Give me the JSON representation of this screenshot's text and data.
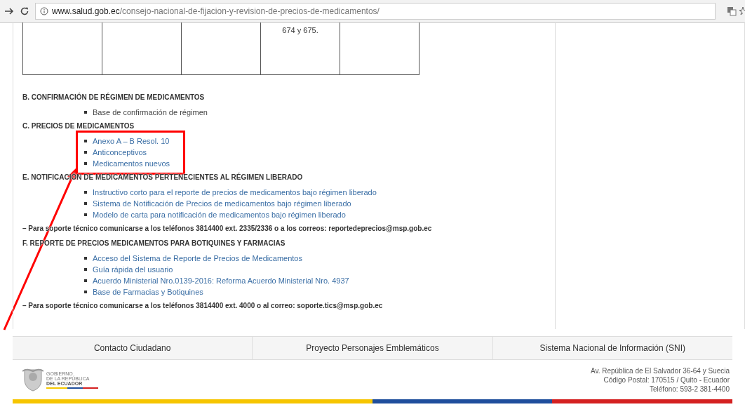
{
  "browser": {
    "url_host": "www.salud.gob.ec",
    "url_path": "/consejo-nacional-de-fijacion-y-revision-de-precios-de-medicamentos/"
  },
  "table": {
    "rows": [
      [
        "",
        "",
        "",
        "674 y 675.",
        ""
      ]
    ]
  },
  "sections": [
    {
      "kind": "heading",
      "text": "B. CONFIRMACIÓN DE RÉGIMEN DE MEDICAMENTOS"
    },
    {
      "kind": "list",
      "items": [
        {
          "text": "Base de confirmación de régimen",
          "link": false
        }
      ]
    },
    {
      "kind": "heading",
      "text": "C. PRECIOS DE MEDICAMENTOS"
    },
    {
      "kind": "list",
      "items": [
        {
          "text": "Anexo A – B Resol. 10",
          "link": true
        },
        {
          "text": "Anticonceptivos",
          "link": true
        },
        {
          "text": "Medicamentos nuevos",
          "link": true
        }
      ]
    },
    {
      "kind": "heading",
      "text": "E. NOTIFICACIÓN DE MEDICAMENTOS PERTENECIENTES AL RÉGIMEN LIBERADO"
    },
    {
      "kind": "list",
      "items": [
        {
          "text": "Instructivo corto para el reporte de precios de medicamentos bajo régimen liberado",
          "link": true
        },
        {
          "text": "Sistema de Notificación de Precios de medicamentos bajo régimen liberado",
          "link": true
        },
        {
          "text": "Modelo de carta para notificación de medicamentos bajo régimen liberado",
          "link": true
        }
      ]
    },
    {
      "kind": "note",
      "text": "– Para soporte técnico comunicarse a los teléfonos 3814400 ext. 2335/2336 o a los correos: reportedeprecios@msp.gob.ec"
    },
    {
      "kind": "heading",
      "text": "F. REPORTE DE PRECIOS MEDICAMENTOS PARA BOTIQUINES Y FARMACIAS"
    },
    {
      "kind": "list",
      "items": [
        {
          "text": "Acceso del Sistema de Reporte de Precios de Medicamentos",
          "link": true
        },
        {
          "text": "Guía rápida del usuario",
          "link": true
        },
        {
          "text": "Acuerdo Ministerial Nro.0139-2016: Reforma Acuerdo Ministerial Nro. 4937",
          "link": true
        },
        {
          "text": "Base de Farmacias y Botiquines",
          "link": true
        }
      ]
    },
    {
      "kind": "note",
      "text": "– Para soporte técnico comunicarse a los teléfonos 3814400 ext. 4000 o al correo: soporte.tics@msp.gob.ec"
    }
  ],
  "footer_links": [
    "Contacto Ciudadano",
    "Proyecto Personajes Emblemáticos",
    "Sistema Nacional de Información (SNI)"
  ],
  "logo": {
    "lines": [
      "GOBIERNO",
      "DE LA REPÚBLICA",
      "DEL ECUADOR"
    ]
  },
  "address": [
    "Av. República de El Salvador 36-64 y Suecia",
    "Código Postal: 170515 / Quito - Ecuador",
    "Teléfono: 593-2 381-4400"
  ]
}
